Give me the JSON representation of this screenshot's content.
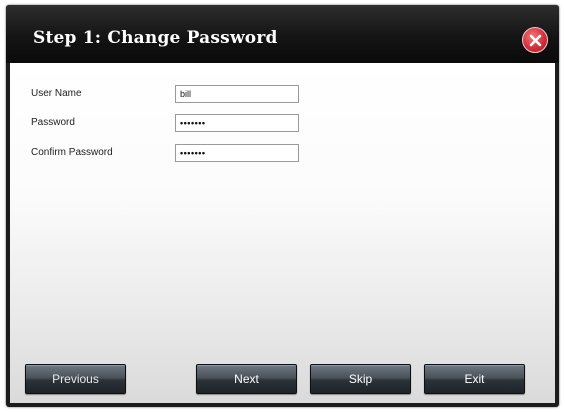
{
  "dialog": {
    "title": "Step 1: Change Password",
    "close_icon": "close-icon"
  },
  "form": {
    "user_name": {
      "label": "User Name",
      "value": "bill"
    },
    "password": {
      "label": "Password",
      "value": "•••••••"
    },
    "confirm_password": {
      "label": "Confirm Password",
      "value": "•••••••"
    }
  },
  "buttons": {
    "previous": "Previous",
    "next": "Next",
    "skip": "Skip",
    "exit": "Exit"
  },
  "colors": {
    "title_bar": "#141414",
    "close_button": "#d0303a",
    "button_face": "#3a4249"
  }
}
